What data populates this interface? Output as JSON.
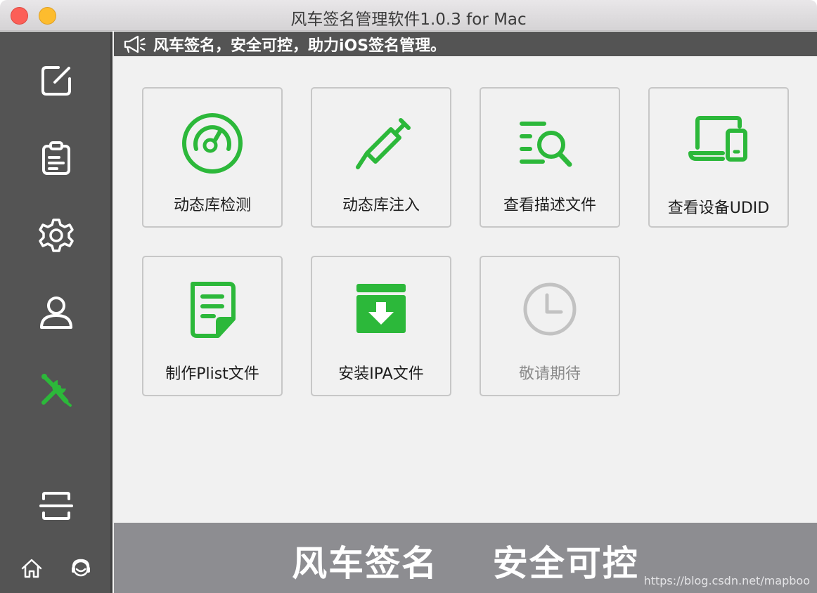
{
  "window": {
    "title": "风车签名管理软件1.0.3  for Mac"
  },
  "sidebar": {
    "items": [
      {
        "icon": "edit-icon",
        "active": false
      },
      {
        "icon": "clipboard-icon",
        "active": false
      },
      {
        "icon": "gear-icon",
        "active": false
      },
      {
        "icon": "user-icon",
        "active": false
      },
      {
        "icon": "tools-icon",
        "active": true
      },
      {
        "icon": "scan-icon",
        "active": false
      }
    ],
    "bottom": [
      {
        "icon": "home-icon"
      },
      {
        "icon": "support-icon"
      }
    ]
  },
  "marquee": {
    "icon": "megaphone-icon",
    "text": "风车签名，安全可控，助力iOS签名管理。"
  },
  "tools": [
    {
      "label": "动态库检测",
      "icon": "gauge-icon"
    },
    {
      "label": "动态库注入",
      "icon": "syringe-icon"
    },
    {
      "label": "查看描述文件",
      "icon": "search-list-icon"
    },
    {
      "label": "查看设备UDID",
      "icon": "devices-icon"
    },
    {
      "label": "制作Plist文件",
      "icon": "document-icon"
    },
    {
      "label": "安装IPA文件",
      "icon": "install-box-icon"
    },
    {
      "label": "敬请期待",
      "icon": "clock-icon",
      "disabled": true
    }
  ],
  "footer": {
    "title": "风车签名    安全可控",
    "watermark": "https://blog.csdn.net/mapboo"
  },
  "colors": {
    "accent": "#2cb83a",
    "sidebar": "#545454",
    "footer": "#8d8d91",
    "disabled": "#c2c2c2"
  }
}
